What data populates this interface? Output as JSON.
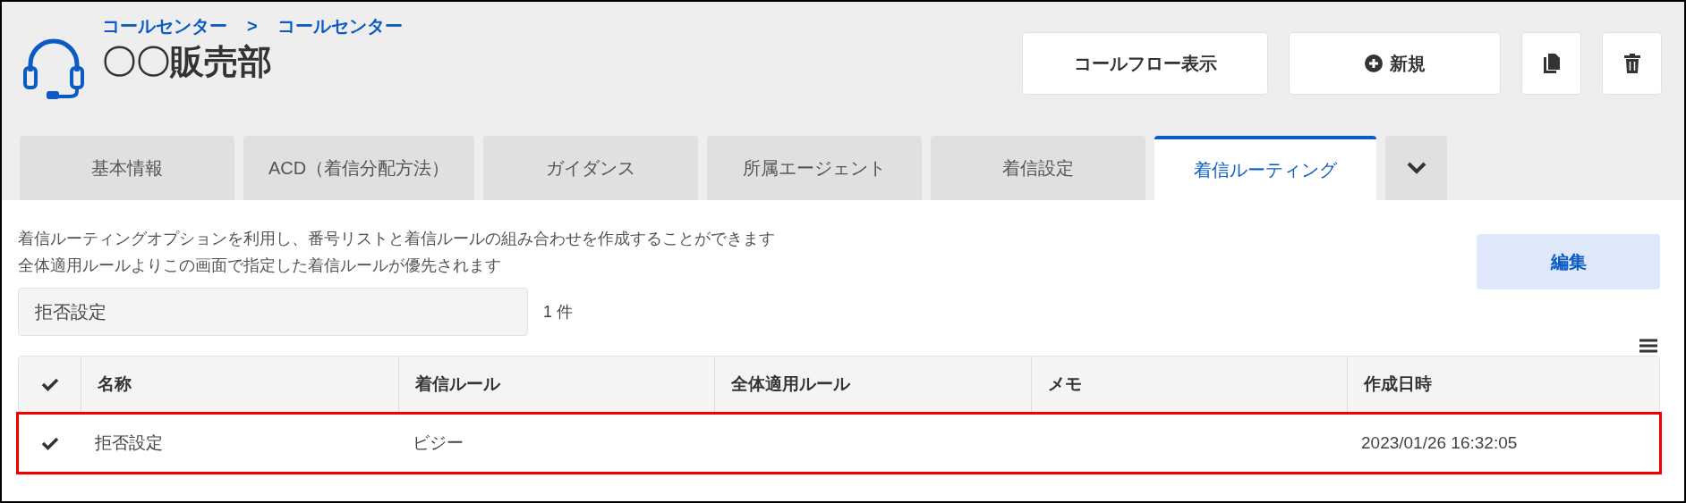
{
  "header": {
    "breadcrumb": [
      "コールセンター",
      ">",
      "コールセンター"
    ],
    "title": "〇〇販売部",
    "buttons": [
      {
        "kind": "text",
        "label": "コールフロー表示"
      },
      {
        "kind": "new",
        "label": "新規"
      },
      {
        "kind": "copy"
      },
      {
        "kind": "delete"
      }
    ]
  },
  "tabs": [
    {
      "label": "基本情報",
      "selected": false
    },
    {
      "label": "ACD（着信分配方法）",
      "selected": false
    },
    {
      "label": "ガイダンス",
      "selected": false
    },
    {
      "label": "所属エージェント",
      "selected": false
    },
    {
      "label": "着信設定",
      "selected": false
    },
    {
      "label": "着信ルーティング",
      "selected": true
    }
  ],
  "description": [
    "着信ルーティングオプションを利用し、番号リストと着信ルールの組み合わせを作成することができます",
    "全体適用ルールよりこの画面で指定した着信ルールが優先されます"
  ],
  "edit_button": "編集",
  "search": {
    "value": "拒否設定"
  },
  "count": "1 件",
  "table": {
    "columns": [
      "名称",
      "着信ルール",
      "全体適用ルール",
      "メモ",
      "作成日時"
    ],
    "rows": [
      {
        "checked": true,
        "highlighted": true,
        "cells": [
          "拒否設定",
          "ビジー",
          "",
          "",
          "2023/01/26 16:32:05"
        ]
      }
    ]
  }
}
